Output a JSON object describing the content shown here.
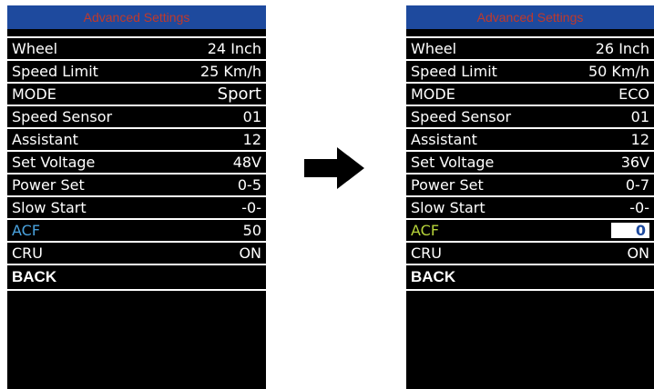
{
  "left_screen": {
    "title": "Advanced Settings",
    "rows": [
      {
        "label": "Wheel",
        "value": "24 Inch"
      },
      {
        "label": "Speed Limit",
        "value": "25 Km/h"
      },
      {
        "label": "MODE",
        "value": "Sport"
      },
      {
        "label": "Speed Sensor",
        "value": "01"
      },
      {
        "label": "Assistant",
        "value": "12"
      },
      {
        "label": "Set Voltage",
        "value": "48V"
      },
      {
        "label": "Power Set",
        "value": "0-5"
      },
      {
        "label": "Slow Start",
        "value": "-0-"
      },
      {
        "label": "ACF",
        "value": "50"
      },
      {
        "label": "CRU",
        "value": "ON"
      }
    ],
    "back_label": "BACK"
  },
  "right_screen": {
    "title": "Advanced Settings",
    "rows": [
      {
        "label": "Wheel",
        "value": "26 Inch"
      },
      {
        "label": "Speed Limit",
        "value": "50 Km/h"
      },
      {
        "label": "MODE",
        "value": "ECO"
      },
      {
        "label": "Speed Sensor",
        "value": "01"
      },
      {
        "label": "Assistant",
        "value": "12"
      },
      {
        "label": "Set Voltage",
        "value": "36V"
      },
      {
        "label": "Power Set",
        "value": "0-7"
      },
      {
        "label": "Slow Start",
        "value": "-0-"
      },
      {
        "label": "ACF",
        "value": "0"
      },
      {
        "label": "CRU",
        "value": "ON"
      }
    ],
    "back_label": "BACK"
  },
  "icons": {
    "transition_arrow": "right-arrow-icon"
  },
  "colors": {
    "title_bar_bg": "#1e4a9e",
    "title_text": "#c0392b",
    "screen_bg": "#000000",
    "acf_highlight_left": "#4aa3df",
    "acf_highlight_right": "#b7d43a"
  }
}
